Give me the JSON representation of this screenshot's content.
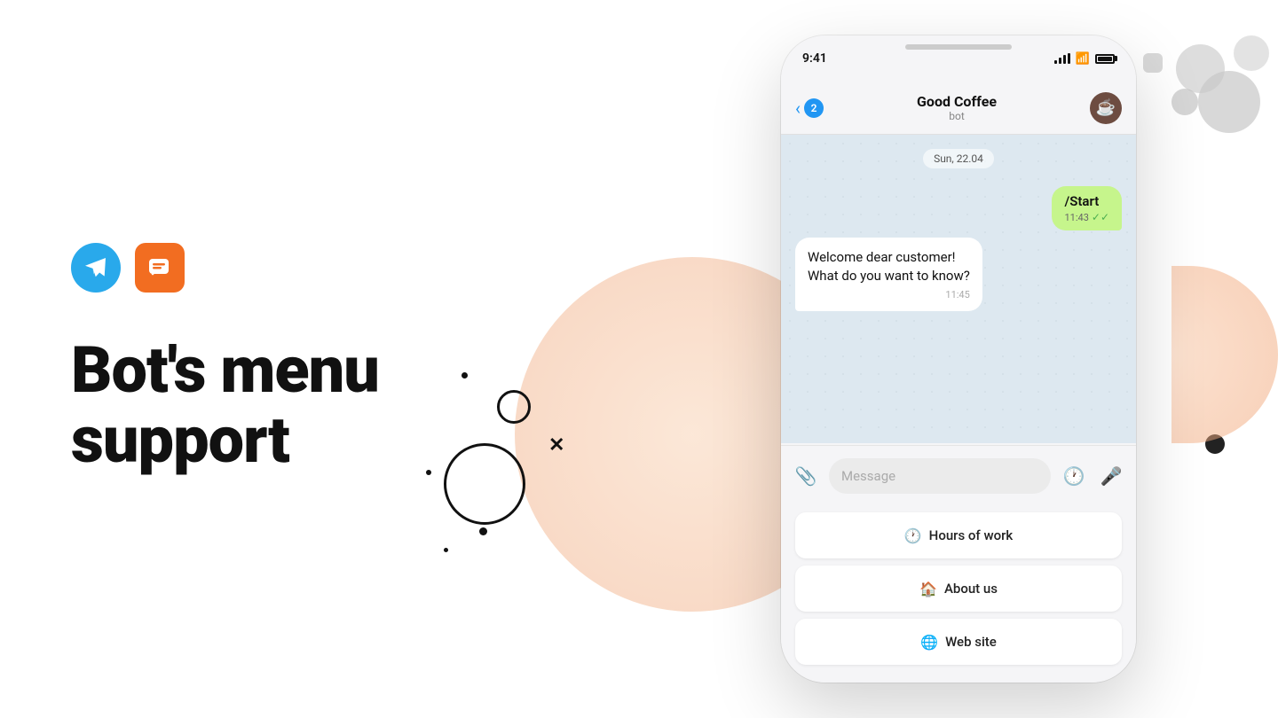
{
  "page": {
    "background": "#ffffff"
  },
  "logos": {
    "telegram_label": "Telegram",
    "chat_label": "Chat"
  },
  "headline": {
    "line1": "Bot's menu",
    "line2": "support"
  },
  "phone": {
    "status_time": "9:41",
    "chat_name": "Good Coffee",
    "chat_status": "bot",
    "unread_count": "2",
    "date_label": "Sun, 22.04",
    "message_out_text": "/Start",
    "message_out_time": "11:43",
    "message_in_text": "Welcome dear customer!\nWhat do you want to know?",
    "message_in_time": "11:45",
    "input_placeholder": "Message",
    "menu_items": [
      {
        "icon": "🕐",
        "label": "Hours of work"
      },
      {
        "icon": "🏠",
        "label": "About us"
      },
      {
        "icon": "🌐",
        "label": "Web site"
      }
    ]
  }
}
